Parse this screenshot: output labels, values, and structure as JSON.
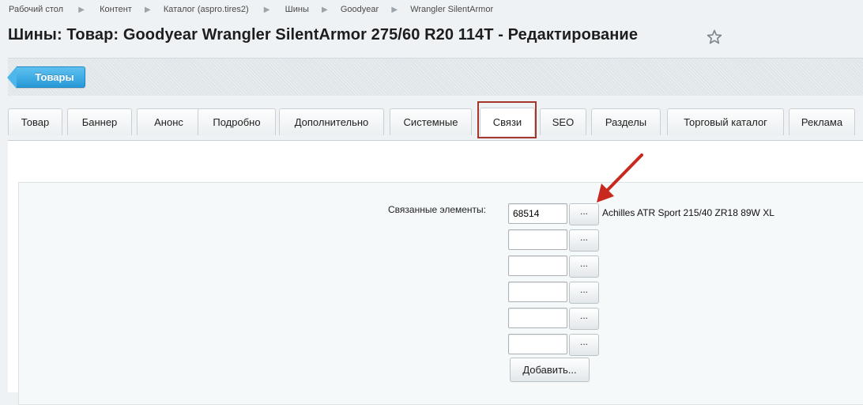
{
  "breadcrumb": {
    "items": [
      "Рабочий стол",
      "Контент",
      "Каталог (aspro.tires2)",
      "Шины",
      "Goodyear",
      "Wrangler SilentArmor"
    ],
    "separator": "▶"
  },
  "page": {
    "title": "Шины: Товар: Goodyear Wrangler SilentArmor 275/60 R20 114T - Редактирование",
    "favorite_icon": "star-icon"
  },
  "toolbar": {
    "back_label": "Товары",
    "accent_color": "#2d9fdc"
  },
  "tabs": {
    "items": [
      "Товар",
      "Баннер",
      "Анонс",
      "Подробно",
      "Дополнительно",
      "Системные",
      "Связи",
      "SEO",
      "Разделы",
      "Торговый каталог",
      "Реклама"
    ],
    "active": "Связи",
    "highlight_color": "#a5362a"
  },
  "links": {
    "label": "Связанные элементы:",
    "pick_label": "...",
    "rows": [
      {
        "value": "68514",
        "name": "Achilles ATR Sport 215/40 ZR18 89W XL"
      },
      {
        "value": "",
        "name": ""
      },
      {
        "value": "",
        "name": ""
      },
      {
        "value": "",
        "name": ""
      },
      {
        "value": "",
        "name": ""
      },
      {
        "value": "",
        "name": ""
      }
    ],
    "add_label": "Добавить..."
  },
  "annotation": {
    "arrow_color": "#c8281d"
  }
}
